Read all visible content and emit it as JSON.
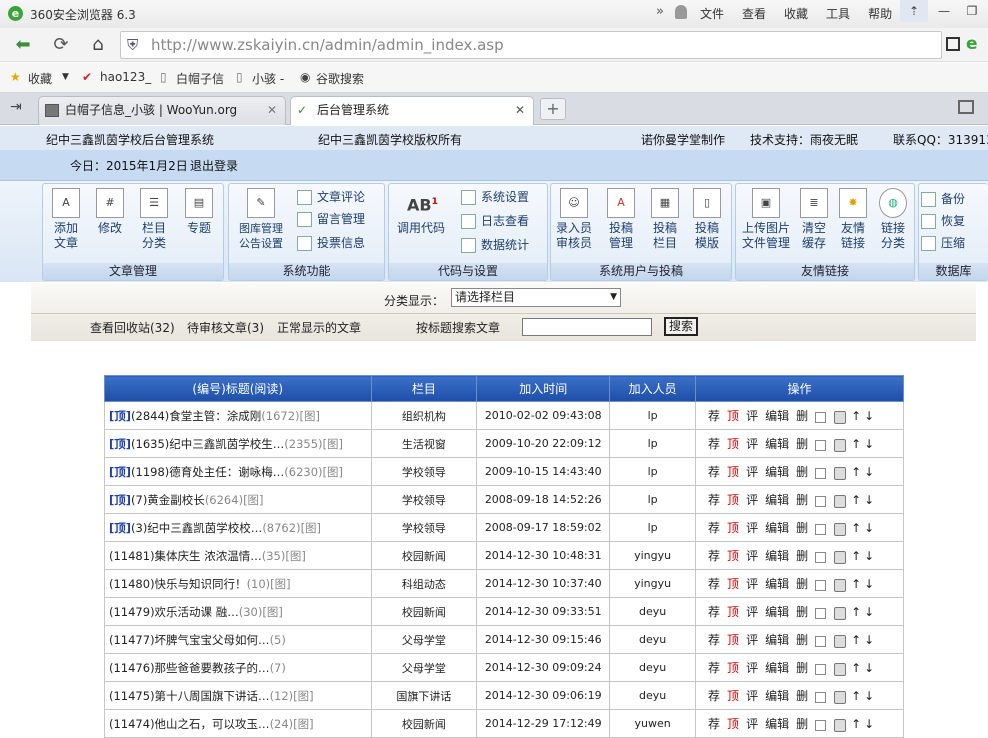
{
  "browser": {
    "title": "360安全浏览器 6.3",
    "menus": [
      "文件",
      "查看",
      "收藏",
      "工具",
      "帮助"
    ],
    "url": "http://www.zskaiyin.cn/admin/admin_index.asp",
    "favorites": [
      "收藏",
      "hao123_",
      "白帽子信",
      "小骇 -",
      "谷歌搜索"
    ],
    "tabs": [
      {
        "label": "白帽子信息_小骇 | WooYun.org"
      },
      {
        "label": "后台管理系统"
      }
    ]
  },
  "site": {
    "left": "纪中三鑫凯茵学校后台管理系统",
    "mid": "纪中三鑫凯茵学校版权所有",
    "maker": "诺你曼学堂制作",
    "support": "技术支持：雨夜无眠",
    "qq": "联系QQ：31391320",
    "date": "今日：2015年1月2日",
    "logout": "退出登录"
  },
  "toolbar": {
    "g1": {
      "title": "文章管理",
      "btns": [
        "添加\n文章",
        "修改",
        "栏目\n分类",
        "专题"
      ]
    },
    "g2": {
      "title": "系统功能",
      "main": "图库管理\n公告设置",
      "links": [
        "文章评论",
        "留言管理",
        "投票信息"
      ]
    },
    "g3": {
      "title": "代码与设置",
      "main": "调用代码",
      "links": [
        "系统设置",
        "日志查看",
        "数据统计"
      ]
    },
    "g4": {
      "title": "系统用户与投稿",
      "btns": [
        "录入员\n审核员",
        "投稿\n管理",
        "投稿\n栏目",
        "投稿\n模版"
      ]
    },
    "g5": {
      "title": "友情链接",
      "btns": [
        "上传图片\n文件管理",
        "清空\n缓存",
        "友情\n链接",
        "链接\n分类"
      ]
    },
    "g6": {
      "title": "数据库",
      "links": [
        "备份",
        "恢复",
        "压缩"
      ]
    }
  },
  "filter": {
    "label": "分类显示：",
    "select": "请选择栏目",
    "recycle": "查看回收站(32)",
    "pending": "待审核文章(3)",
    "normal": "正常显示的文章",
    "search_label": "按标题搜索文章",
    "search_btn": "搜索"
  },
  "table": {
    "headers": [
      "(编号)标题(阅读)",
      "栏目",
      "加入时间",
      "加入人员",
      "操作"
    ],
    "ops": [
      "荐",
      "顶",
      "评",
      "编辑",
      "删"
    ],
    "rows": [
      {
        "top": true,
        "title": "(2844)食堂主管：涂成刚",
        "reads": "(1672)",
        "img": "[图]",
        "col": "组织机构",
        "time": "2010-02-02 09:43:08",
        "user": "lp"
      },
      {
        "top": true,
        "title": "(1635)纪中三鑫凯茵学校生…",
        "reads": "(2355)",
        "img": "[图]",
        "col": "生活视窗",
        "time": "2009-10-20 22:09:12",
        "user": "lp"
      },
      {
        "top": true,
        "title": "(1198)德育处主任：谢咏梅…",
        "reads": "(6230)",
        "img": "[图]",
        "col": "学校领导",
        "time": "2009-10-15 14:43:40",
        "user": "lp"
      },
      {
        "top": true,
        "title": "(7)黄金副校长",
        "reads": "(6264)",
        "img": "[图]",
        "col": "学校领导",
        "time": "2008-09-18 14:52:26",
        "user": "lp"
      },
      {
        "top": true,
        "title": "(3)纪中三鑫凯茵学校校…",
        "reads": "(8762)",
        "img": "[图]",
        "col": "学校领导",
        "time": "2008-09-17 18:59:02",
        "user": "lp"
      },
      {
        "top": false,
        "title": "(11481)集体庆生 浓浓温情…",
        "reads": "(35)",
        "img": "[图]",
        "col": "校园新闻",
        "time": "2014-12-30 10:48:31",
        "user": "yingyu"
      },
      {
        "top": false,
        "title": "(11480)快乐与知识同行！",
        "reads": "(10)",
        "img": "[图]",
        "col": "科组动态",
        "time": "2014-12-30 10:37:40",
        "user": "yingyu"
      },
      {
        "top": false,
        "title": "(11479)欢乐活动课 融…",
        "reads": "(30)",
        "img": "[图]",
        "col": "校园新闻",
        "time": "2014-12-30 09:33:51",
        "user": "deyu"
      },
      {
        "top": false,
        "title": "(11477)坏脾气宝宝父母如何…",
        "reads": "(5)",
        "img": "",
        "col": "父母学堂",
        "time": "2014-12-30 09:15:46",
        "user": "deyu"
      },
      {
        "top": false,
        "title": "(11476)那些爸爸要教孩子的…",
        "reads": "(7)",
        "img": "",
        "col": "父母学堂",
        "time": "2014-12-30 09:09:24",
        "user": "deyu"
      },
      {
        "top": false,
        "title": "(11475)第十八周国旗下讲话…",
        "reads": "(12)",
        "img": "[图]",
        "col": "国旗下讲话",
        "time": "2014-12-30 09:06:19",
        "user": "deyu"
      },
      {
        "top": false,
        "title": "(11474)他山之石，可以攻玉…",
        "reads": "(24)",
        "img": "[图]",
        "col": "校园新闻",
        "time": "2014-12-29 17:12:49",
        "user": "yuwen"
      }
    ]
  }
}
